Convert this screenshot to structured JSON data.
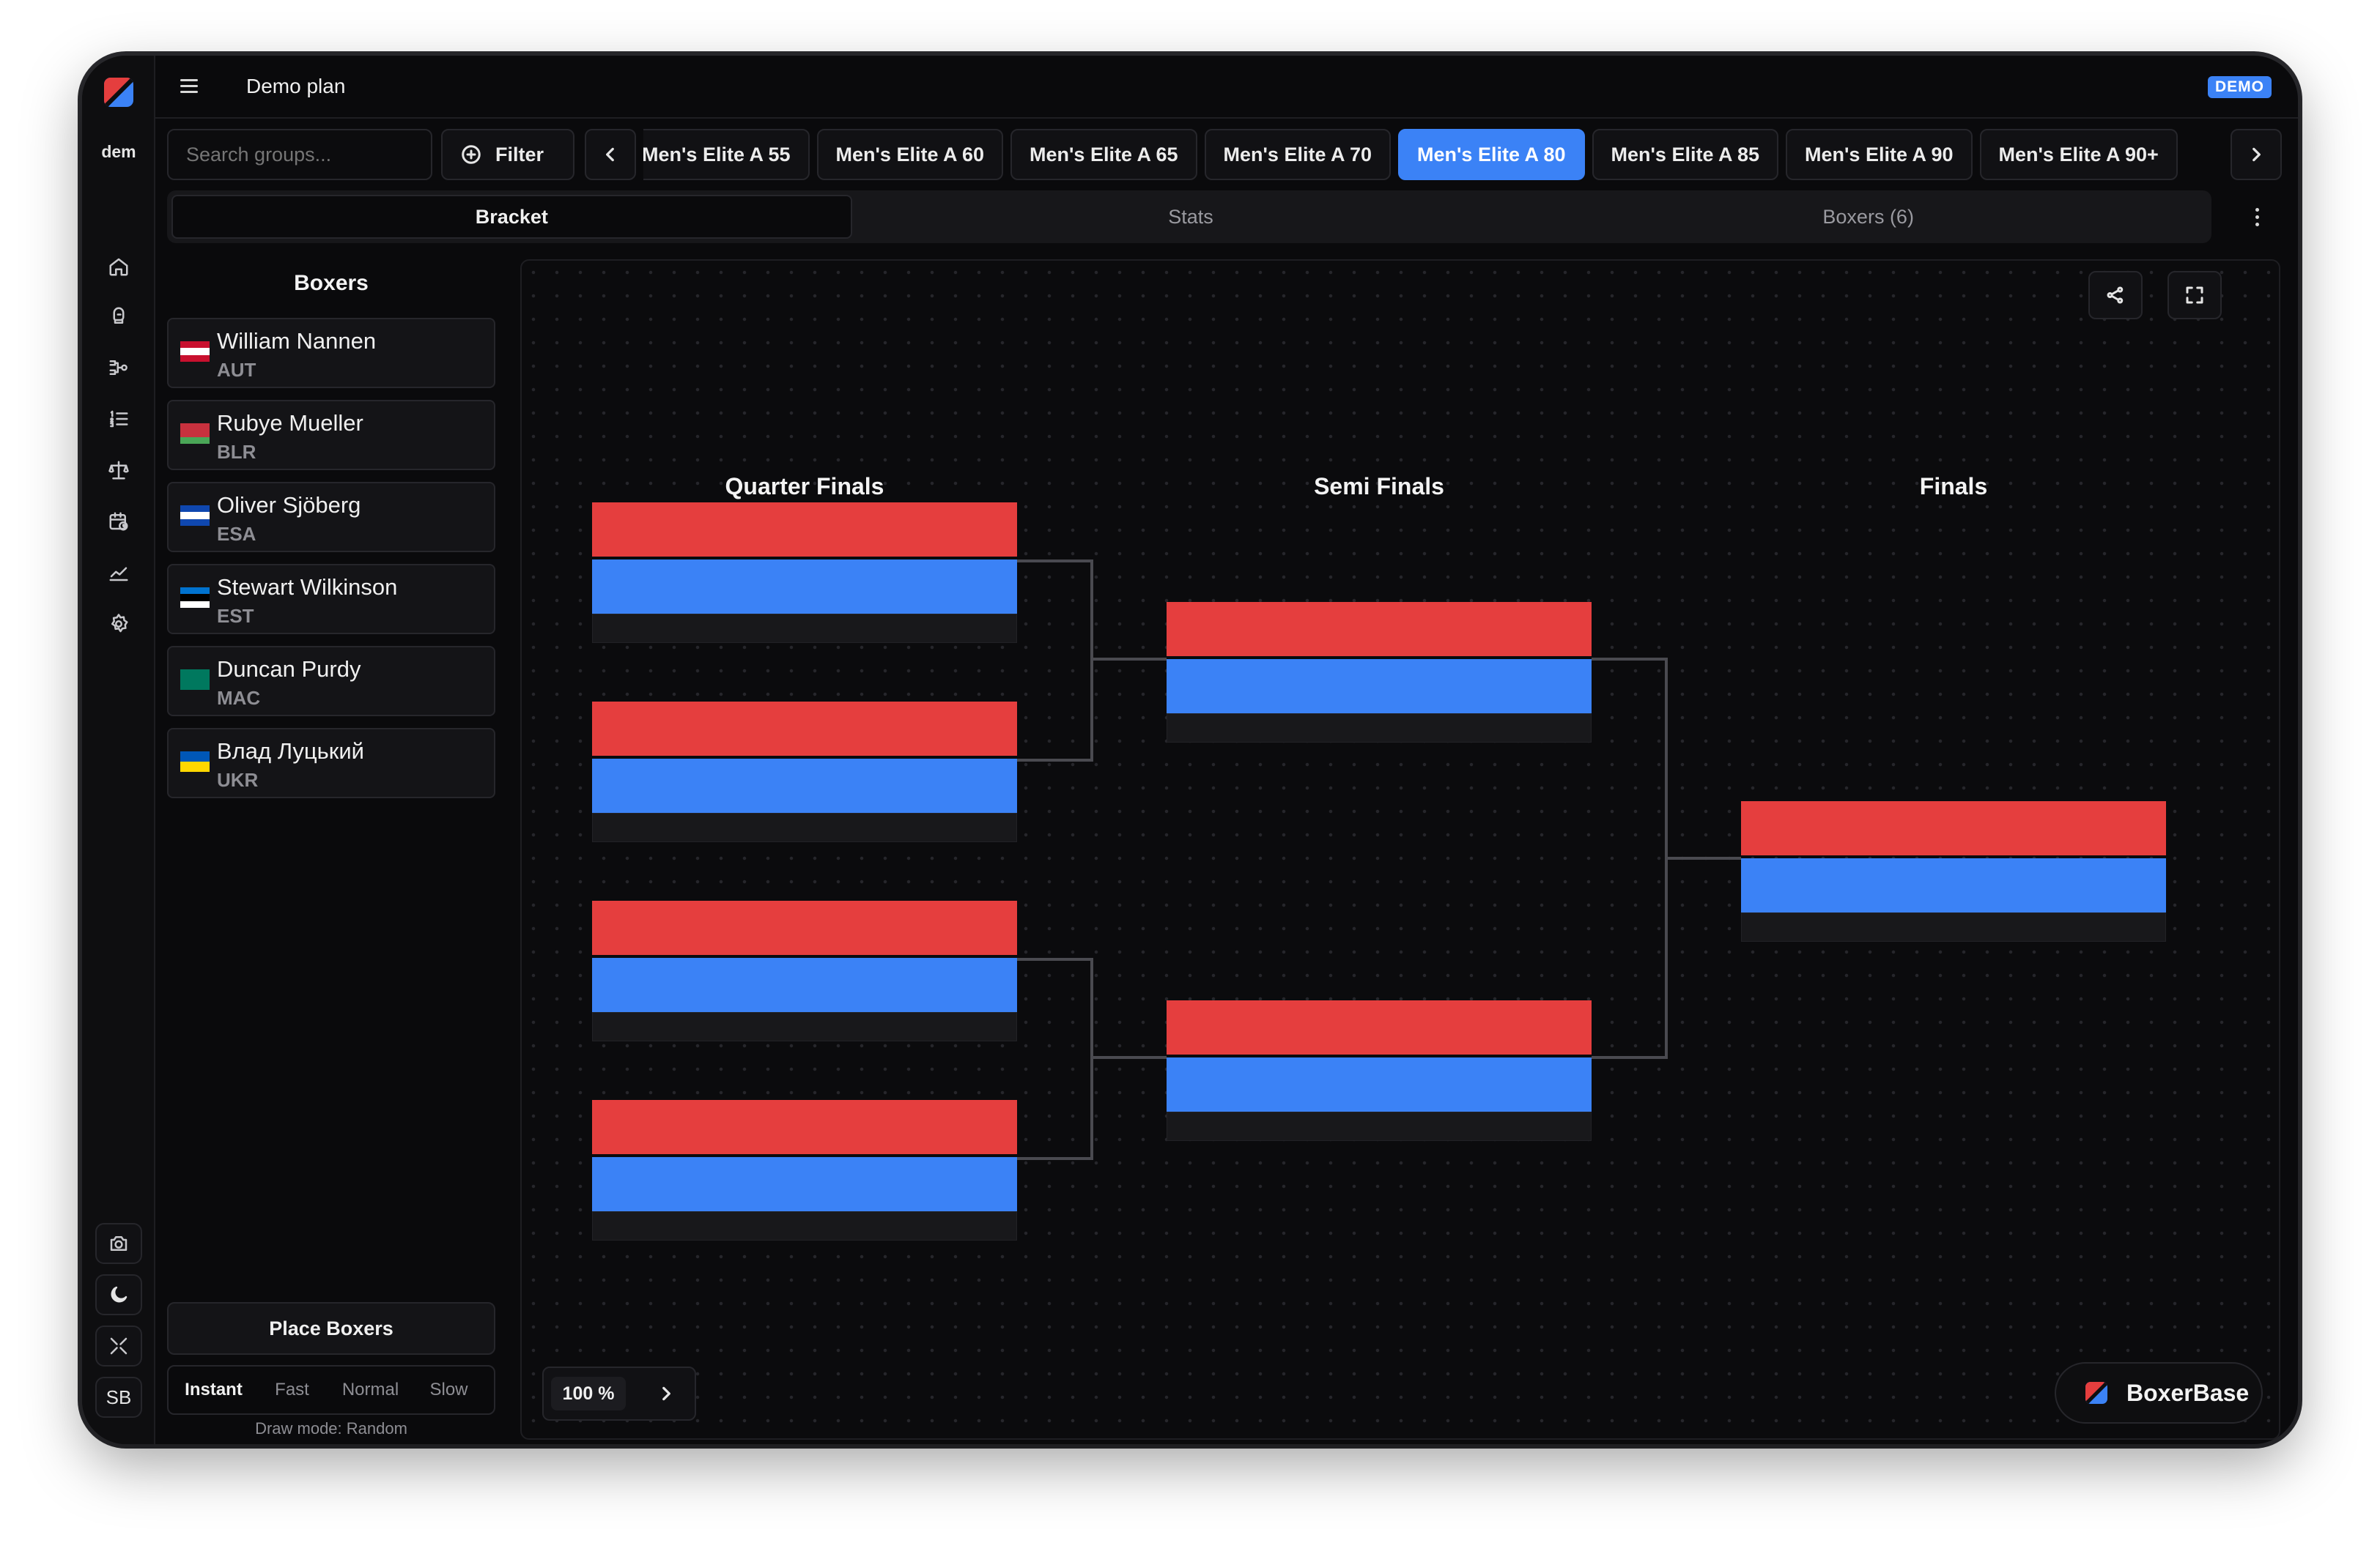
{
  "app": {
    "tenant": "dem",
    "plan_title": "Demo plan",
    "badge": "DEMO",
    "profile_initials": "SB"
  },
  "toolbar": {
    "search_placeholder": "Search groups...",
    "filter_label": "Filter",
    "weight_tabs": [
      {
        "label": "Men's Elite A 55",
        "active": false
      },
      {
        "label": "Men's Elite A 60",
        "active": false
      },
      {
        "label": "Men's Elite A 65",
        "active": false
      },
      {
        "label": "Men's Elite A 70",
        "active": false
      },
      {
        "label": "Men's Elite A 80",
        "active": true
      },
      {
        "label": "Men's Elite A 85",
        "active": false
      },
      {
        "label": "Men's Elite A 90",
        "active": false
      },
      {
        "label": "Men's Elite A 90+",
        "active": false
      }
    ]
  },
  "view_tabs": [
    {
      "label": "Bracket",
      "active": true
    },
    {
      "label": "Stats",
      "active": false
    },
    {
      "label": "Boxers (6)",
      "active": false
    }
  ],
  "boxers_panel": {
    "title": "Boxers",
    "boxers": [
      {
        "name": "William Nannen",
        "country": "AUT",
        "flag_colors": [
          "#c8102e",
          "#ffffff",
          "#c8102e"
        ]
      },
      {
        "name": "Rubye Mueller",
        "country": "BLR",
        "flag_colors": [
          "#c8313e",
          "#c8313e",
          "#4aa657"
        ]
      },
      {
        "name": "Oliver Sjöberg",
        "country": "ESA",
        "flag_colors": [
          "#0f47af",
          "#ffffff",
          "#0f47af"
        ]
      },
      {
        "name": "Stewart Wilkinson",
        "country": "EST",
        "flag_colors": [
          "#0072ce",
          "#000000",
          "#ffffff"
        ]
      },
      {
        "name": "Duncan Purdy",
        "country": "MAC",
        "flag_colors": [
          "#00785e",
          "#00785e",
          "#00785e"
        ]
      },
      {
        "name": "Влад Луцький",
        "country": "UKR",
        "flag_colors": [
          "#0057b7",
          "#ffd700"
        ]
      }
    ],
    "place_button": "Place Boxers",
    "speeds": [
      {
        "label": "Instant",
        "active": true
      },
      {
        "label": "Fast",
        "active": false
      },
      {
        "label": "Normal",
        "active": false
      },
      {
        "label": "Slow",
        "active": false
      }
    ],
    "draw_mode": "Draw mode: Random"
  },
  "bracket": {
    "rounds": [
      "Quarter Finals",
      "Semi Finals",
      "Finals"
    ],
    "corner_colors": {
      "red": "#e53e3e",
      "blue": "#3b82f6"
    },
    "zoom": "100 %"
  },
  "brand": {
    "name": "BoxerBase"
  },
  "colors": {
    "accent": "#3b82f6",
    "red_corner": "#e53e3e"
  }
}
